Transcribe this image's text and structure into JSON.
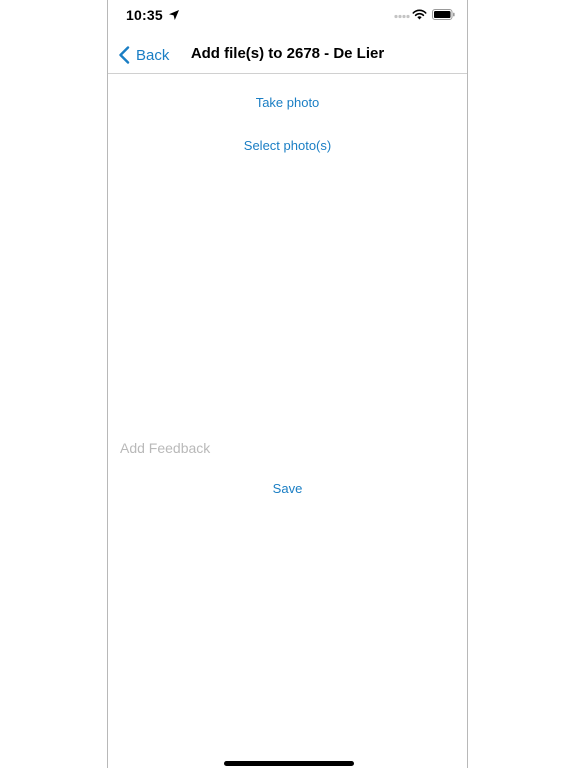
{
  "status_bar": {
    "time": "10:35",
    "icons": [
      "location-arrow-icon",
      "signal-icon",
      "wifi-icon",
      "battery-icon"
    ]
  },
  "nav": {
    "back_label": "Back",
    "title": "Add file(s) to 2678 - De Lier"
  },
  "actions": {
    "take_photo": "Take photo",
    "select_photos": "Select photo(s)",
    "save": "Save"
  },
  "feedback": {
    "placeholder": "Add Feedback",
    "value": ""
  },
  "colors": {
    "accent": "#1a7ec4",
    "placeholder": "#b9b9b9",
    "text": "#000000",
    "background": "#ffffff"
  }
}
